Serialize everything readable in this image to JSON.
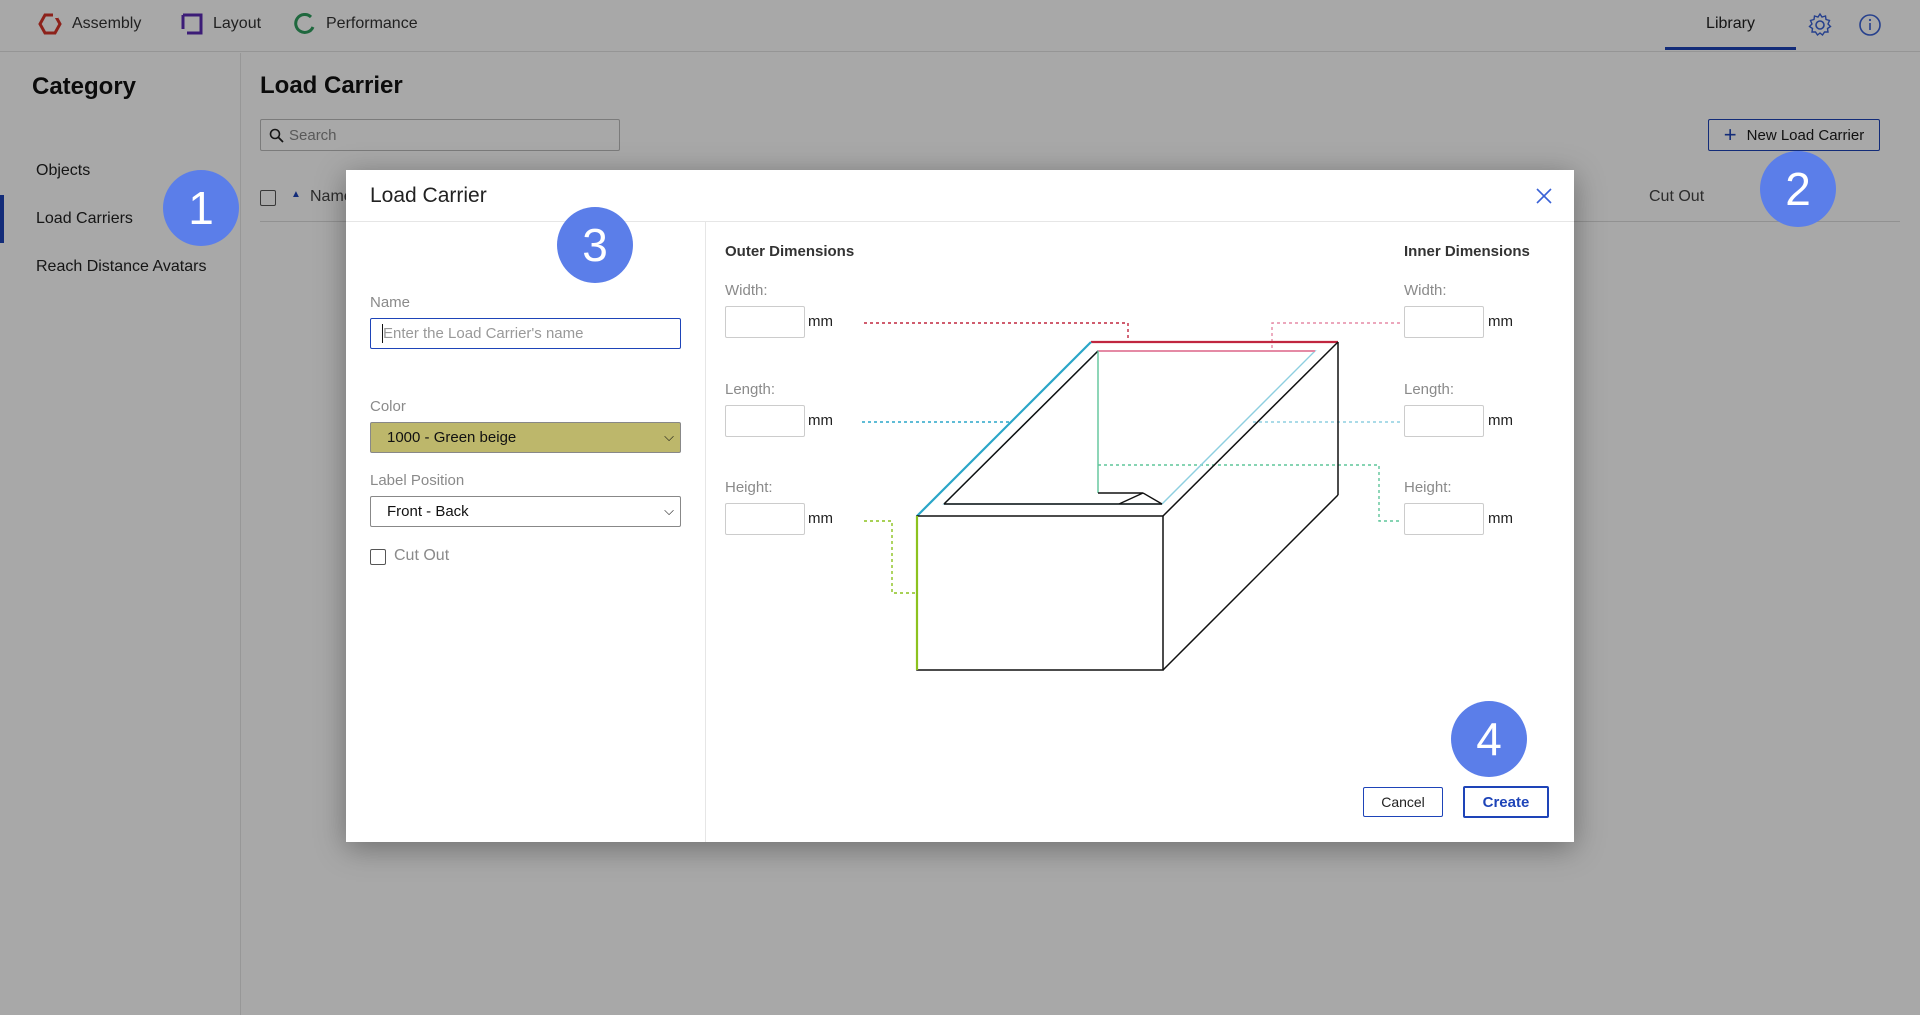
{
  "topbar": {
    "nav": [
      {
        "label": "Assembly",
        "icon": "assembly-icon",
        "color": "#d7342a"
      },
      {
        "label": "Layout",
        "icon": "layout-icon",
        "color": "#5b2bb5"
      },
      {
        "label": "Performance",
        "icon": "performance-icon",
        "color": "#2f9e5f"
      }
    ],
    "library_tab": "Library",
    "settings_icon": "gear-icon",
    "info_icon": "info-icon"
  },
  "sidebar": {
    "title": "Category",
    "items": [
      {
        "label": "Objects"
      },
      {
        "label": "Load Carriers",
        "active": true
      },
      {
        "label": "Reach Distance Avatars"
      }
    ]
  },
  "main": {
    "title": "Load Carrier",
    "search_placeholder": "Search",
    "new_button": "New Load Carrier",
    "columns": {
      "name": "Name",
      "cut_out": "Cut Out"
    }
  },
  "modal": {
    "title": "Load Carrier",
    "name_label": "Name",
    "name_placeholder": "Enter the Load Carrier's name",
    "color_label": "Color",
    "color_value": "1000 - Green beige",
    "color_swatch": "#bdb76b",
    "label_position_label": "Label Position",
    "label_position_value": "Front - Back",
    "cut_out_label": "Cut Out",
    "outer": {
      "heading": "Outer Dimensions",
      "width": "Width:",
      "length": "Length:",
      "height": "Height:",
      "unit": "mm"
    },
    "inner": {
      "heading": "Inner Dimensions",
      "width": "Width:",
      "length": "Length:",
      "height": "Height:",
      "unit": "mm"
    },
    "cancel": "Cancel",
    "create": "Create"
  },
  "markers": [
    "1",
    "2",
    "3",
    "4"
  ],
  "colors": {
    "accent": "#1e44b8",
    "marker": "#5b7ee9",
    "outer_width_line": "#c0263f",
    "outer_length_line": "#2aa6c8",
    "outer_height_line": "#8cc21f",
    "inner_width_line": "#e58aa5",
    "inner_length_line": "#8ecfe0",
    "inner_height_line": "#5fc59a"
  }
}
